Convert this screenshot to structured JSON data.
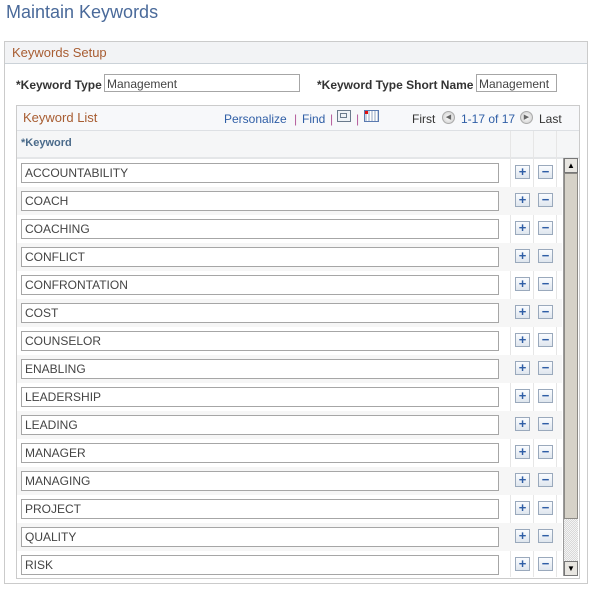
{
  "page": {
    "title": "Maintain Keywords"
  },
  "setup": {
    "header": "Keywords Setup",
    "keyword_type_label": "*Keyword Type",
    "keyword_type_value": "Management",
    "short_name_label": "*Keyword Type Short Name",
    "short_name_value": "Management"
  },
  "grid": {
    "title": "Keyword List",
    "personalize": "Personalize",
    "find": "Find",
    "separator": "|",
    "first": "First",
    "range": "1-17 of 17",
    "last": "Last",
    "column_header": "*Keyword",
    "add_symbol": "+",
    "delete_symbol": "−",
    "rows": [
      "ACCOUNTABILITY",
      "COACH",
      "COACHING",
      "CONFLICT",
      "CONFRONTATION",
      "COST",
      "COUNSELOR",
      "ENABLING",
      "LEADERSHIP",
      "LEADING",
      "MANAGER",
      "MANAGING",
      "PROJECT",
      "QUALITY",
      "RISK"
    ]
  }
}
